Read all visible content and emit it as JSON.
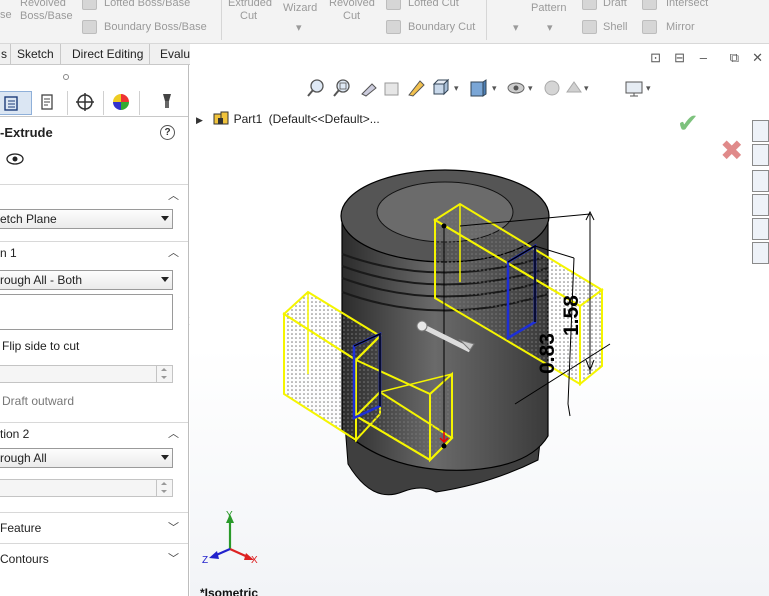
{
  "ribbon": {
    "items": [
      {
        "name": "revolved-boss-label",
        "line1": "Revolved",
        "line2": "Boss/Base"
      },
      {
        "name": "lofted-boss-label",
        "text": "Lofted Boss/Base"
      },
      {
        "name": "boundary-boss-label",
        "text": "Boundary Boss/Base"
      },
      {
        "name": "extruded-cut-label",
        "line1": "Extruded",
        "line2": "Cut"
      },
      {
        "name": "hole-wizard-label",
        "text": "Wizard"
      },
      {
        "name": "revolved-cut-label",
        "line1": "Revolved",
        "line2": "Cut"
      },
      {
        "name": "lofted-cut-label",
        "text": "Lofted Cut"
      },
      {
        "name": "boundary-cut-label",
        "text": "Boundary Cut"
      },
      {
        "name": "pattern-label",
        "text": "Pattern"
      },
      {
        "name": "draft-label",
        "text": "Draft"
      },
      {
        "name": "shell-label",
        "text": "Shell"
      },
      {
        "name": "intersect-label",
        "text": "Intersect"
      },
      {
        "name": "mirror-label",
        "text": "Mirror"
      }
    ],
    "left_fragments": [
      "se",
      "e"
    ]
  },
  "tabs": [
    "s",
    "Sketch",
    "Direct Editing",
    "Evaluate"
  ],
  "feature": {
    "title": "-Extrude",
    "help": "?"
  },
  "panel": {
    "from_combo": "etch Plane",
    "direction1_header": "n 1",
    "direction1_combo": "rough All - Both",
    "flip_side": "Flip side to cut",
    "draft_outward": "Draft outward",
    "direction2_header": "tion 2",
    "direction2_combo": "rough All",
    "feature_scope": "Feature",
    "selected_contours": "Contours"
  },
  "tree": {
    "part": "Part1",
    "config": "(Default<<Default>..."
  },
  "dimensions": {
    "d1": "1.58",
    "d2": "0.83"
  },
  "view_label": "*Isometric",
  "triad": {
    "y": "Y",
    "x": "X",
    "z": "Z"
  },
  "colors": {
    "preview": "#f5f500",
    "sketch": "#1e2fd6",
    "body": "#4a4a4a"
  }
}
